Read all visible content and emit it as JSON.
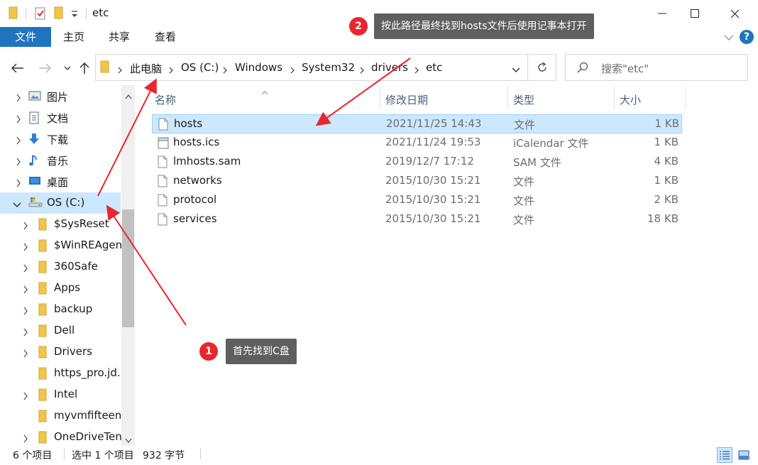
{
  "window": {
    "title": "etc",
    "minimize_glyph": "─",
    "close_glyph": "✕"
  },
  "ribbon": {
    "tabs": [
      "文件",
      "主页",
      "共享",
      "查看"
    ],
    "help": "?"
  },
  "address": {
    "crumbs": [
      "此电脑",
      "OS (C:)",
      "Windows",
      "System32",
      "drivers",
      "etc"
    ]
  },
  "search": {
    "placeholder": "搜索\"etc\""
  },
  "sidebar": {
    "items": [
      {
        "label": "图片",
        "icon": "pictures-icon"
      },
      {
        "label": "文档",
        "icon": "documents-icon"
      },
      {
        "label": "下载",
        "icon": "downloads-icon"
      },
      {
        "label": "音乐",
        "icon": "music-icon"
      },
      {
        "label": "桌面",
        "icon": "desktop-icon"
      },
      {
        "label": "OS (C:)",
        "icon": "drive-icon"
      },
      {
        "label": "$SysReset",
        "icon": "folder-icon"
      },
      {
        "label": "$WinREAgen",
        "icon": "folder-icon"
      },
      {
        "label": "360Safe",
        "icon": "folder-icon"
      },
      {
        "label": "Apps",
        "icon": "folder-icon"
      },
      {
        "label": "backup",
        "icon": "folder-icon"
      },
      {
        "label": "Dell",
        "icon": "folder-icon"
      },
      {
        "label": "Drivers",
        "icon": "folder-icon"
      },
      {
        "label": "https_pro.jd.",
        "icon": "folder-icon"
      },
      {
        "label": "Intel",
        "icon": "folder-icon"
      },
      {
        "label": "myvmfifteen",
        "icon": "folder-icon"
      },
      {
        "label": "OneDriveTen",
        "icon": "folder-icon"
      }
    ]
  },
  "columns": {
    "name": "名称",
    "modified": "修改日期",
    "type": "类型",
    "size": "大小"
  },
  "files": [
    {
      "name": "hosts",
      "modified": "2021/11/25 14:43",
      "type": "文件",
      "size": "1 KB",
      "selected": true
    },
    {
      "name": "hosts.ics",
      "modified": "2021/11/24 19:53",
      "type": "iCalendar 文件",
      "size": "1 KB",
      "selected": false
    },
    {
      "name": "lmhosts.sam",
      "modified": "2019/12/7 17:12",
      "type": "SAM 文件",
      "size": "4 KB",
      "selected": false
    },
    {
      "name": "networks",
      "modified": "2015/10/30 15:21",
      "type": "文件",
      "size": "1 KB",
      "selected": false
    },
    {
      "name": "protocol",
      "modified": "2015/10/30 15:21",
      "type": "文件",
      "size": "2 KB",
      "selected": false
    },
    {
      "name": "services",
      "modified": "2015/10/30 15:21",
      "type": "文件",
      "size": "18 KB",
      "selected": false
    }
  ],
  "status": {
    "count": "6 个项目",
    "selection": "选中 1 个项目",
    "size": "932 字节"
  },
  "annotations": {
    "step1": {
      "number": "1",
      "text": "首先找到C盘"
    },
    "step2": {
      "number": "2",
      "text": "按此路径最终找到hosts文件后使用记事本打开"
    }
  },
  "colors": {
    "accent": "#1e74bd",
    "selection": "#cce8ff",
    "annotation_red": "#e8262d",
    "callout_bg": "#5f5f5f",
    "folder": "#f0c54a"
  }
}
